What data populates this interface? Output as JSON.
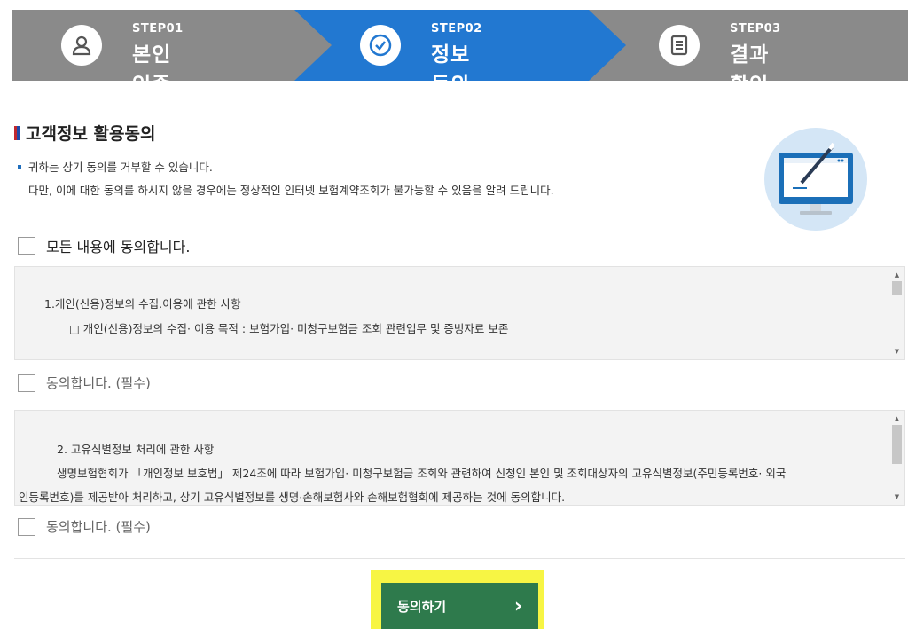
{
  "steps": [
    {
      "num": "STEP01",
      "name": "본인인증",
      "icon": "person-icon"
    },
    {
      "num": "STEP02",
      "name": "정보동의",
      "icon": "check-circle-icon",
      "active": true
    },
    {
      "num": "STEP03",
      "name": "결과확인",
      "icon": "document-icon"
    }
  ],
  "colors": {
    "stepbar": "#8a8a8a",
    "active_step": "#2278d1",
    "button": "#2e7a4c",
    "highlight": "#f7f544"
  },
  "section": {
    "title": "고객정보 활용동의",
    "notice_line1": "귀하는 상기 동의를 거부할 수 있습니다.",
    "notice_line2": "다만, 이에 대한 동의를 하시지 않을 경우에는 정상적인 인터넷 보험계약조회가 불가능할 수 있음을 알려 드립니다."
  },
  "agree_all_label": "모든 내용에 동의합니다.",
  "terms": [
    {
      "heading": "1.개인(신용)정보의 수집.이용에 관한 사항",
      "body": "□ 개인(신용)정보의 수집· 이용 목적 : 보험가입· 미청구보험금 조회 관련업무 및 증빙자료 보존",
      "agree_label": "동의합니다. (필수)"
    },
    {
      "heading": "2. 고유식별정보 처리에 관한 사항",
      "body": "생명보험협회가 「개인정보 보호법」 제24조에 따라 보험가입· 미청구보험금 조회와 관련하여 신청인 본인 및 조회대상자의 고유식별정보(주민등록번호· 외국",
      "body2": "인등록번호)를 제공받아 처리하고, 상기 고유식별정보를 생명·손해보험사와 손해보험협회에 제공하는 것에 동의합니다.",
      "agree_label": "동의합니다. (필수)"
    }
  ],
  "submit": {
    "label": "동의하기",
    "arrow": "›"
  }
}
